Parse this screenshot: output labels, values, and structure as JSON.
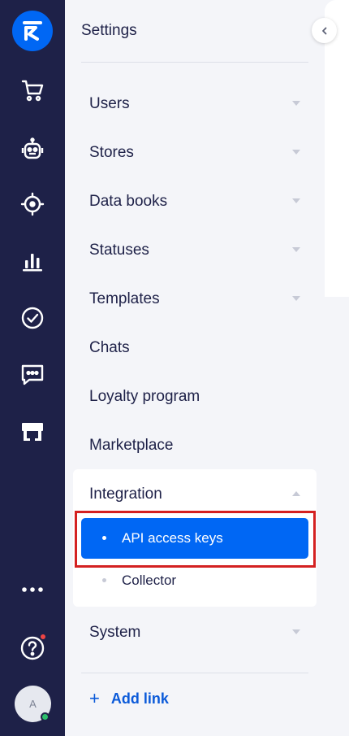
{
  "colors": {
    "rail_bg": "#1e2148",
    "accent": "#0067f4",
    "panel_bg": "#f4f5f9",
    "text": "#1e2148",
    "highlight_border": "#d42121"
  },
  "rail": {
    "icons": [
      "logo-icon",
      "cart-icon",
      "bot-icon",
      "target-icon",
      "analytics-icon",
      "check-circle-icon",
      "chat-icon",
      "store-icon",
      "more-icon",
      "help-icon"
    ],
    "avatar_initial": "A"
  },
  "settings": {
    "title": "Settings",
    "items": [
      {
        "label": "Users",
        "expandable": true
      },
      {
        "label": "Stores",
        "expandable": true
      },
      {
        "label": "Data books",
        "expandable": true
      },
      {
        "label": "Statuses",
        "expandable": true
      },
      {
        "label": "Templates",
        "expandable": true
      },
      {
        "label": "Chats",
        "expandable": false
      },
      {
        "label": "Loyalty program",
        "expandable": false
      },
      {
        "label": "Marketplace",
        "expandable": false
      },
      {
        "label": "Integration",
        "expandable": true,
        "expanded": true,
        "children": [
          {
            "label": "API access keys",
            "active": true
          },
          {
            "label": "Collector",
            "active": false
          }
        ]
      },
      {
        "label": "System",
        "expandable": true
      }
    ],
    "add_link_label": "Add link"
  }
}
